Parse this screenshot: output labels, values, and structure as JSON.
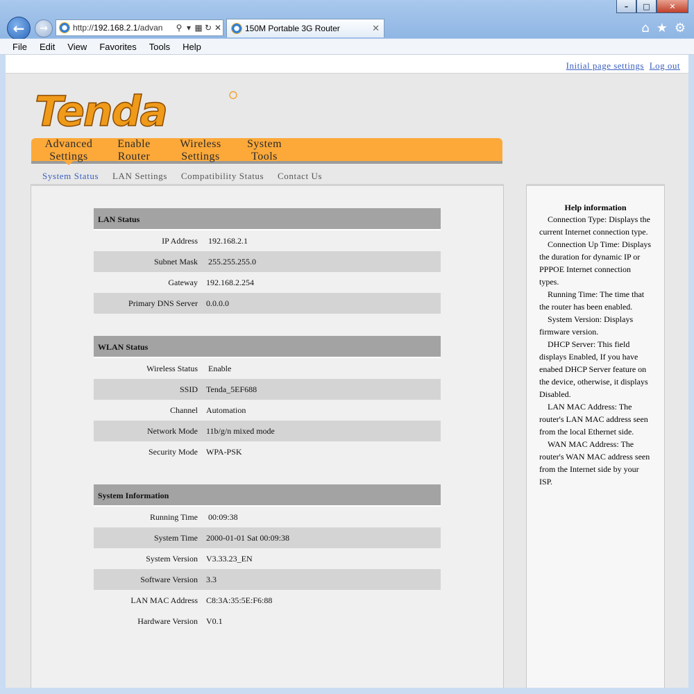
{
  "browser": {
    "url_prefix": "http://",
    "url_host": "192.168.2.1",
    "url_rest": "/advan",
    "tab_title": "150M Portable 3G Router",
    "menu": [
      "File",
      "Edit",
      "View",
      "Favorites",
      "Tools",
      "Help"
    ]
  },
  "top_links": {
    "initial": "Initial page settings",
    "logout": "Log out"
  },
  "logo_text": "Tenda",
  "main_nav": [
    {
      "line1": "Advanced",
      "line2": "Settings"
    },
    {
      "line1": "Enable",
      "line2": "Router"
    },
    {
      "line1": "Wireless",
      "line2": "Settings"
    },
    {
      "line1": "System",
      "line2": "Tools"
    }
  ],
  "sub_nav": [
    "System Status",
    "LAN Settings",
    "Compatibility Status",
    "Contact Us"
  ],
  "lan_status": {
    "title": "LAN Status",
    "rows": [
      {
        "label": "IP Address",
        "value": "192.168.2.1"
      },
      {
        "label": "Subnet Mask",
        "value": "255.255.255.0"
      },
      {
        "label": "Gateway",
        "value": "192.168.2.254"
      },
      {
        "label": "Primary DNS Server",
        "value": "0.0.0.0"
      }
    ]
  },
  "wlan_status": {
    "title": "WLAN Status",
    "rows": [
      {
        "label": "Wireless Status",
        "value": "Enable"
      },
      {
        "label": "SSID",
        "value": "Tenda_5EF688"
      },
      {
        "label": "Channel",
        "value": "Automation"
      },
      {
        "label": "Network Mode",
        "value": "11b/g/n mixed mode"
      },
      {
        "label": "Security Mode",
        "value": "WPA-PSK"
      }
    ]
  },
  "system_info": {
    "title": "System Information",
    "rows": [
      {
        "label": "Running Time",
        "value": "00:09:38"
      },
      {
        "label": "System Time",
        "value": "2000-01-01 Sat 00:09:38"
      },
      {
        "label": "System Version",
        "value": "V3.33.23_EN"
      },
      {
        "label": "Software Version",
        "value": "3.3"
      },
      {
        "label": "LAN MAC Address",
        "value": "C8:3A:35:5E:F6:88"
      },
      {
        "label": "Hardware Version",
        "value": "V0.1"
      }
    ]
  },
  "help": {
    "title": "Help information",
    "paragraphs": [
      "Connection Type: Displays the current Internet connection type.",
      "Connection Up Time: Displays the duration for dynamic IP or PPPOE Internet connection types.",
      "Running Time: The time that the router has been enabled.",
      "System Version: Displays firmware version.",
      "DHCP Server: This field displays Enabled, If you have enabed DHCP Server feature on the device, otherwise, it displays Disabled.",
      "LAN MAC Address: The router's LAN MAC address seen from the local Ethernet side.",
      "WAN MAC Address: The router's WAN MAC address seen from the Internet side by your ISP."
    ]
  },
  "colors": {
    "nav_orange": "#fca93a",
    "link_blue": "#3a5fbf",
    "section_head": "#a3a3a3"
  }
}
